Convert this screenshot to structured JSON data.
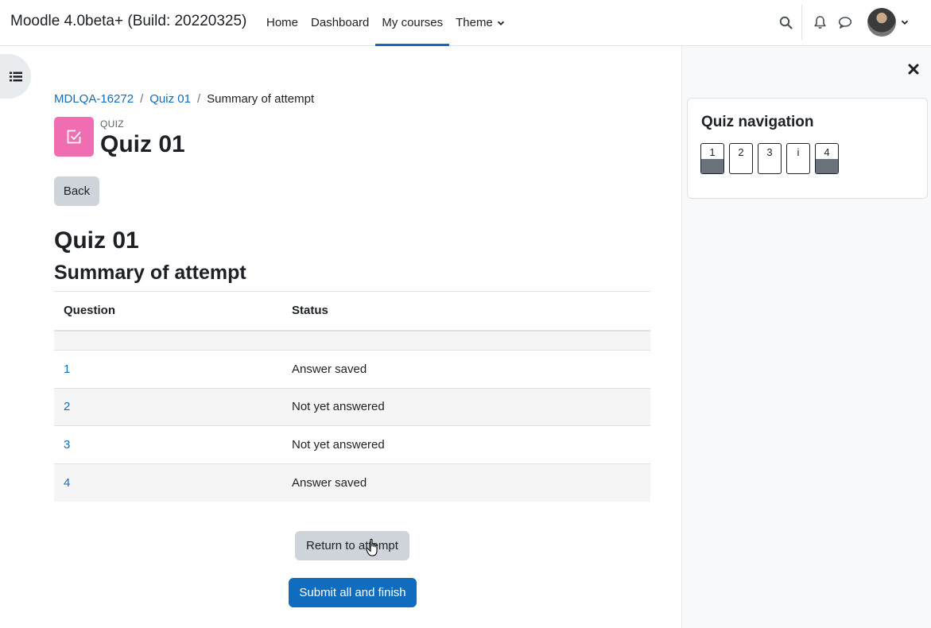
{
  "site": {
    "name": "Moodle 4.0beta+ (Build: 20220325)"
  },
  "nav": {
    "items": [
      {
        "label": "Home",
        "active": false
      },
      {
        "label": "Dashboard",
        "active": false
      },
      {
        "label": "My courses",
        "active": true
      },
      {
        "label": "Theme",
        "active": false,
        "has_dropdown": true
      }
    ]
  },
  "icons": {
    "search": "search-icon",
    "notifications": "bell-icon",
    "messages": "chat-bubble-icon",
    "drawer_left": "list-icon",
    "drawer_close": "close-icon"
  },
  "breadcrumb": {
    "items": [
      "MDLQA-16272",
      "Quiz 01"
    ],
    "current": "Summary of attempt"
  },
  "activity": {
    "label": "QUIZ",
    "title": "Quiz 01",
    "icon_color": "#f06db2"
  },
  "back_button": "Back",
  "page": {
    "heading": "Quiz 01",
    "subheading": "Summary of attempt"
  },
  "table": {
    "headers": [
      "Question",
      "Status"
    ],
    "rows": [
      {
        "question": "1",
        "status": "Answer saved"
      },
      {
        "question": "2",
        "status": "Not yet answered"
      },
      {
        "question": "3",
        "status": "Not yet answered"
      },
      {
        "question": "4",
        "status": "Answer saved"
      }
    ]
  },
  "actions": {
    "return_label": "Return to attempt",
    "submit_label": "Submit all and finish"
  },
  "quiz_navigation": {
    "title": "Quiz navigation",
    "buttons": [
      {
        "label": "1",
        "answered": true
      },
      {
        "label": "2",
        "answered": false
      },
      {
        "label": "3",
        "answered": false
      },
      {
        "label": "i",
        "answered": false
      },
      {
        "label": "4",
        "answered": true
      }
    ]
  },
  "colors": {
    "primary": "#0f6cbf",
    "secondary_button": "#ced4da",
    "answered_fill": "#6a737b"
  }
}
